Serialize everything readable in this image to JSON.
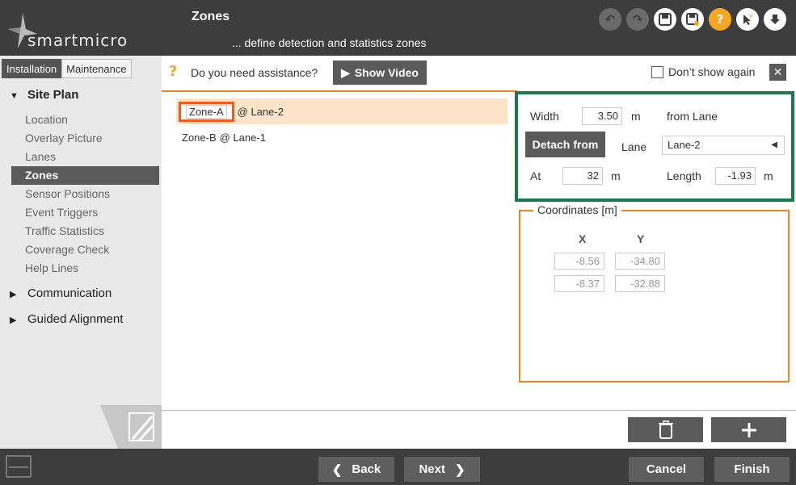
{
  "brand": {
    "logo_text": "smartmicro"
  },
  "header": {
    "title": "Zones",
    "subtitle": "... define detection and statistics zones",
    "icons": [
      "undo-icon",
      "redo-icon",
      "save-icon",
      "save-as-icon",
      "help-icon",
      "context-help-icon",
      "download-icon"
    ]
  },
  "sidebar": {
    "tabs": [
      {
        "label": "Installation"
      },
      {
        "label": "Maintenance"
      }
    ],
    "site_plan": {
      "label": "Site Plan"
    },
    "items": [
      {
        "label": "Location"
      },
      {
        "label": "Overlay Picture"
      },
      {
        "label": "Lanes"
      },
      {
        "label": "Zones"
      },
      {
        "label": "Sensor Positions"
      },
      {
        "label": "Event Triggers"
      },
      {
        "label": "Traffic Statistics"
      },
      {
        "label": "Coverage Check"
      },
      {
        "label": "Help Lines"
      }
    ],
    "communication": {
      "label": "Communication"
    },
    "guided_alignment": {
      "label": "Guided Alignment"
    }
  },
  "assist": {
    "question": "Do you need assistance?",
    "show_video": "Show Video",
    "dont_show": "Don’t show again"
  },
  "zones": [
    {
      "name": "Zone-A",
      "lane": "@ Lane-2"
    },
    {
      "name": "Zone-B",
      "lane": "@ Lane-1"
    }
  ],
  "detail": {
    "width_label": "Width",
    "width_value": "3.50",
    "width_unit": "m",
    "from_lane": "from Lane",
    "detach_label": "Detach from",
    "lane_label": "Lane",
    "lane_value": "Lane-2",
    "at_label": "At",
    "at_value": "32",
    "at_unit": "m",
    "length_label": "Length",
    "length_value": "-1.93",
    "length_unit": "m"
  },
  "coordinates": {
    "legend": "Coordinates [m]",
    "x_header": "X",
    "y_header": "Y",
    "rows": [
      {
        "x": "-8.56",
        "y": "-34.80"
      },
      {
        "x": "-8.37",
        "y": "-32.88"
      }
    ]
  },
  "footer": {
    "back": "Back",
    "next": "Next",
    "cancel": "Cancel",
    "finish": "Finish"
  },
  "colors": {
    "header_bg": "#3d3d3d",
    "accent_orange": "#e8871e",
    "highlight_red": "#f05a1a",
    "panel_green": "#1a7a4c",
    "selected_row": "#fde4c8"
  }
}
